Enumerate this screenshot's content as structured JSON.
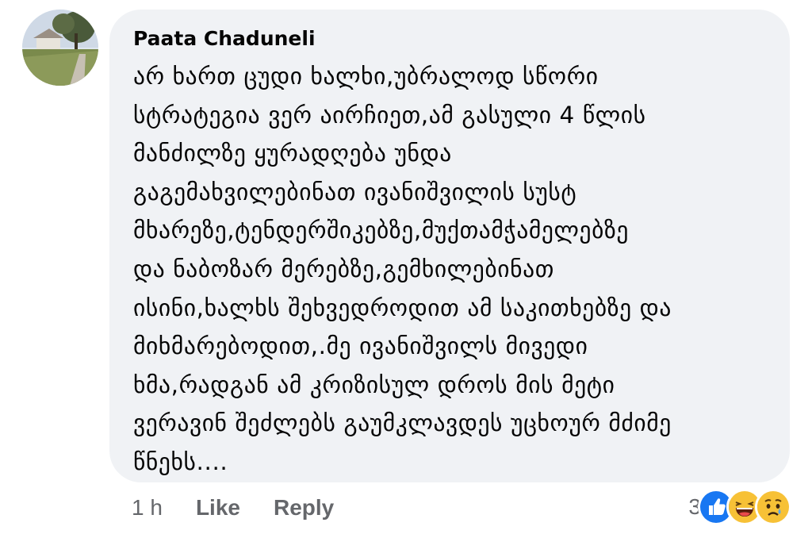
{
  "comment": {
    "author": "Paata Chaduneli",
    "text": "არ ხართ ცუდი ხალხი,უბრალოდ სწორი\nსტრატეგია ვერ აირჩიეთ,ამ გასული 4 წლის\nმანძილზე ყურადღება უნდა\nგაგემახვილებინათ ივანიშვილის სუსტ\nმხარეზე,ტენდერშიკებზე,მუქთამჭამელებზე\nდა ნაბოზარ მერებზე,გემხილებინათ\nისინი,ხალხს შეხვედროდით ამ საკითხებზე და\nმიხმარებოდით,.მე ივანიშვილს მივედი\nხმა,რადგან ამ კრიზისულ დროს მის მეტი\nვერავინ შეძლებს გაუმკლავდეს უცხოურ მძიმე\nწნეხს...."
  },
  "actions": {
    "time": "1 h",
    "like": "Like",
    "reply": "Reply"
  },
  "reactions": {
    "count": "3",
    "icons": [
      "like-icon",
      "haha-icon",
      "sad-icon"
    ]
  },
  "colors": {
    "bubble": "#f0f2f5",
    "text": "#050505",
    "meta": "#65676b",
    "like_blue": "#1877f2",
    "emoji_yellow": "#f7c136"
  }
}
